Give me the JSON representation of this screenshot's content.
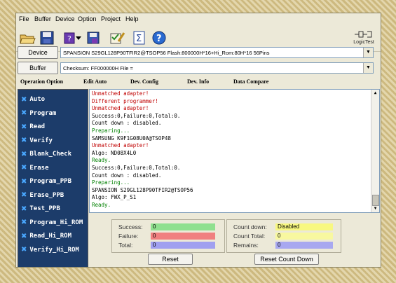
{
  "menu": [
    "File",
    "Buffer",
    "Device",
    "Option",
    "Project",
    "Help"
  ],
  "logo_text": "LogicTest",
  "device_button": "Device",
  "device_value": "SPANSION  S29GL128P90TFIR2@TSOP56  Flash:800000H*16+Hi_Rom:80H*16  56Pins",
  "buffer_button": "Buffer",
  "buffer_value": "Checksum: FF000000H    File =",
  "tabs": [
    "Operation Option",
    "Edit Auto",
    "Dev. Config",
    "Dev. Info",
    "Data Compare"
  ],
  "operations": [
    "Auto",
    "Program",
    "Read",
    "Verify",
    "Blank_Check",
    "Erase",
    "Program_PPB",
    "Erase_PPB",
    "Test_PPB",
    "Program_Hi_ROM",
    "Read_Hi_ROM",
    "Verify_Hi_ROM"
  ],
  "log": [
    {
      "text": "Unmatched adapter!",
      "color": "#c00000"
    },
    {
      "text": "Different programmer!",
      "color": "#c00000"
    },
    {
      "text": "Unmatched adapter!",
      "color": "#c00000"
    },
    {
      "text": "Success:0,Failure:0,Total:0.",
      "color": "#000000"
    },
    {
      "text": "Count down : disabled.",
      "color": "#000000"
    },
    {
      "text": "Preparing...",
      "color": "#008000"
    },
    {
      "text": "SAMSUNG K9F1G08U0A@TSOP48",
      "color": "#000000"
    },
    {
      "text": "Unmatched adapter!",
      "color": "#c00000"
    },
    {
      "text": "Algo: ND08X4L0",
      "color": "#000000"
    },
    {
      "text": "Ready.",
      "color": "#008000"
    },
    {
      "text": "Success:0,Failure:0,Total:0.",
      "color": "#000000"
    },
    {
      "text": "Count down : disabled.",
      "color": "#000000"
    },
    {
      "text": "Preparing...",
      "color": "#008000"
    },
    {
      "text": "SPANSION S29GL128P90TFIR2@TSOP56",
      "color": "#000000"
    },
    {
      "text": "Algo: FWX_P_S1",
      "color": "#000000"
    },
    {
      "text": "Ready.",
      "color": "#008000"
    }
  ],
  "stats": {
    "success_label": "Success:",
    "success_value": "0",
    "failure_label": "Failure:",
    "failure_value": "0",
    "total_label": "Total:",
    "total_value": "0",
    "reset_button": "Reset",
    "countdown_label": "Count down:",
    "countdown_value": "Disabled",
    "count_total_label": "Count Total:",
    "count_total_value": "0",
    "remains_label": "Remains:",
    "remains_value": "0",
    "reset_count_button": "Reset Count Down"
  },
  "colors": {
    "success": "#8fe08f",
    "failure": "#f08080",
    "total": "#a0a0f0",
    "countdown": "#f8f880",
    "count_total": "#f8f8a0",
    "remains": "#a8a8f0",
    "panel": "#1c3c6a"
  }
}
